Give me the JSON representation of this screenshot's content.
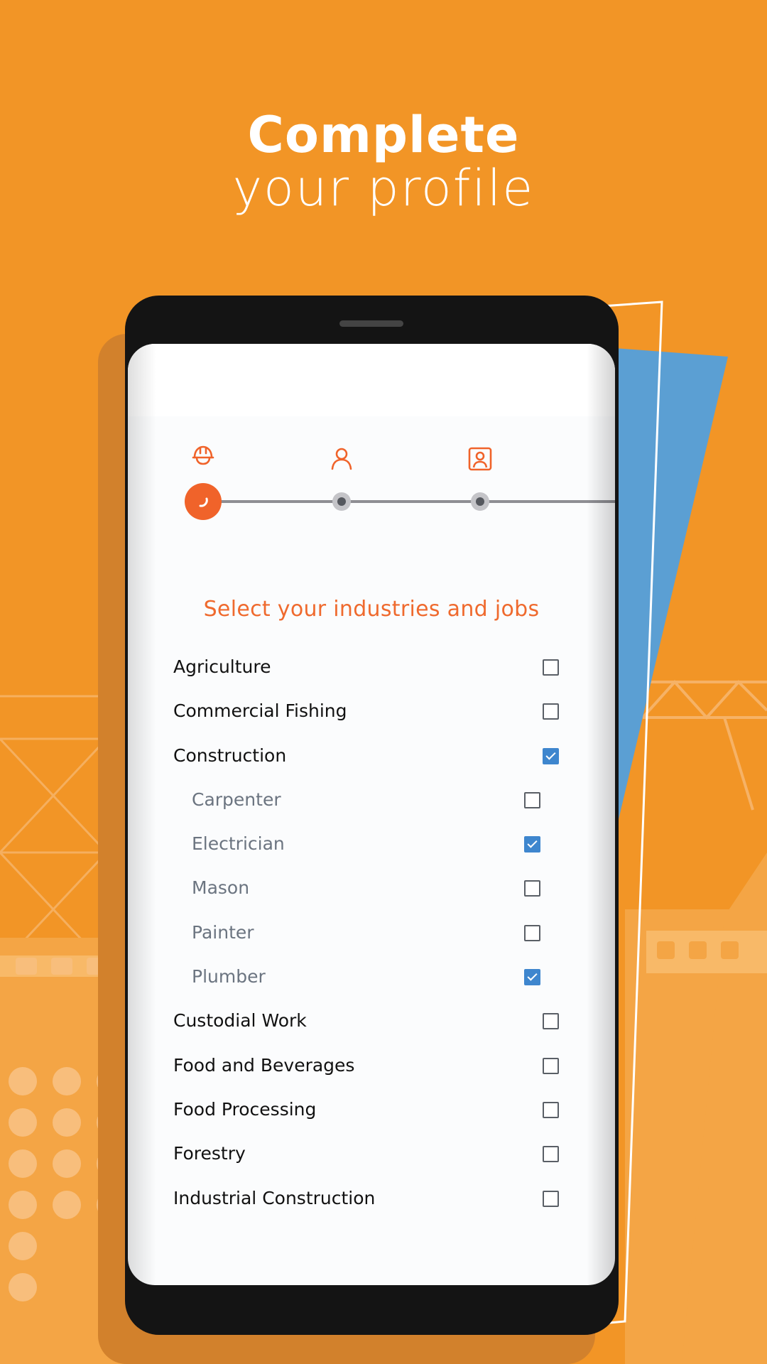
{
  "header": {
    "title_bold": "Complete",
    "title_light": "your profile"
  },
  "colors": {
    "background": "#F29526",
    "accent": "#F0632A",
    "checkbox_checked": "#3E86CE",
    "deco_blue": "#5B9FD3"
  },
  "stepper": {
    "steps": [
      {
        "icon": "hardhat-icon",
        "state": "active"
      },
      {
        "icon": "person-icon",
        "state": "pending"
      },
      {
        "icon": "id-card-icon",
        "state": "pending"
      }
    ]
  },
  "form": {
    "title": "Select your industries and jobs",
    "items": [
      {
        "label": "Agriculture",
        "checked": false,
        "sub": false
      },
      {
        "label": "Commercial Fishing",
        "checked": false,
        "sub": false
      },
      {
        "label": "Construction",
        "checked": true,
        "sub": false
      },
      {
        "label": "Carpenter",
        "checked": false,
        "sub": true
      },
      {
        "label": "Electrician",
        "checked": true,
        "sub": true
      },
      {
        "label": "Mason",
        "checked": false,
        "sub": true
      },
      {
        "label": "Painter",
        "checked": false,
        "sub": true
      },
      {
        "label": "Plumber",
        "checked": true,
        "sub": true
      },
      {
        "label": "Custodial Work",
        "checked": false,
        "sub": false
      },
      {
        "label": "Food and Beverages",
        "checked": false,
        "sub": false
      },
      {
        "label": "Food Processing",
        "checked": false,
        "sub": false
      },
      {
        "label": "Forestry",
        "checked": false,
        "sub": false
      },
      {
        "label": "Industrial Construction",
        "checked": false,
        "sub": false
      }
    ]
  }
}
